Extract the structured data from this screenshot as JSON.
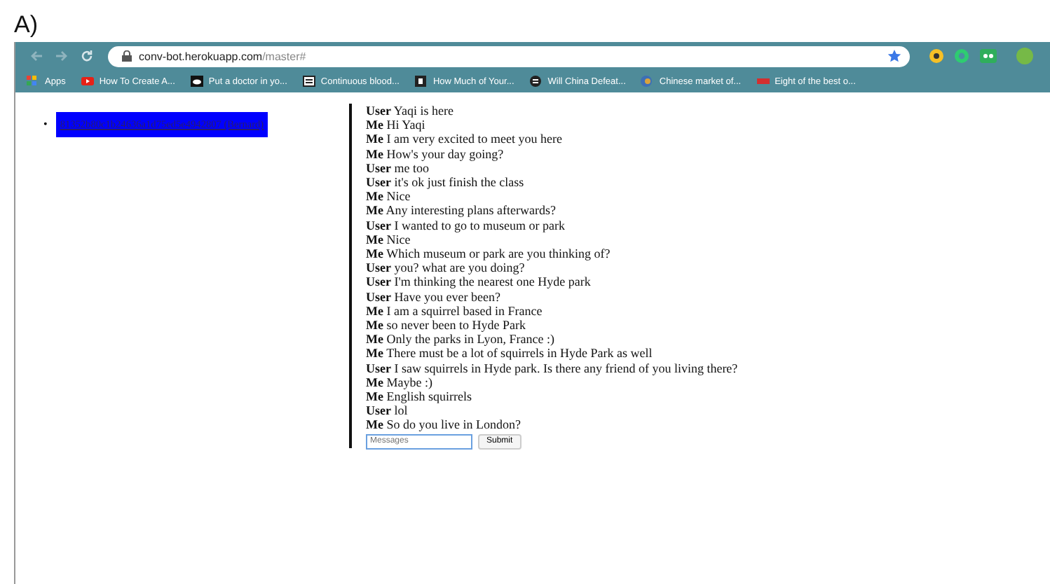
{
  "panel_label": "A)",
  "browser": {
    "url_host": "conv-bot.herokuapp.com",
    "url_path": "/master#",
    "bookmarks": [
      {
        "label": "Apps",
        "kind": "apps"
      },
      {
        "label": "How To Create A...",
        "kind": "video"
      },
      {
        "label": "Put a doctor in yo...",
        "kind": "cloud"
      },
      {
        "label": "Continuous blood...",
        "kind": "doc"
      },
      {
        "label": "How Much of Your...",
        "kind": "letter"
      },
      {
        "label": "Will China Defeat...",
        "kind": "dark"
      },
      {
        "label": "Chinese market of...",
        "kind": "globe"
      },
      {
        "label": "Eight of the best o...",
        "kind": "flag"
      }
    ]
  },
  "sessions": [
    {
      "marker": "•",
      "label": "81352b80c1b24636a1d75ed5e4942807 (Bernard)",
      "selected": true
    }
  ],
  "messages": [
    {
      "sender": "User",
      "text": "Yaqi is here"
    },
    {
      "sender": "Me",
      "text": "Hi Yaqi"
    },
    {
      "sender": "Me",
      "text": "I am very excited to meet you here"
    },
    {
      "sender": "Me",
      "text": "How's your day going?"
    },
    {
      "sender": "User",
      "text": "me too"
    },
    {
      "sender": "User",
      "text": "it's ok just finish the class"
    },
    {
      "sender": "Me",
      "text": "Nice"
    },
    {
      "sender": "Me",
      "text": "Any interesting plans afterwards?"
    },
    {
      "sender": "User",
      "text": "I wanted to go to museum or park"
    },
    {
      "sender": "Me",
      "text": "Nice"
    },
    {
      "sender": "Me",
      "text": "Which museum or park are you thinking of?"
    },
    {
      "sender": "User",
      "text": "you? what are you doing?"
    },
    {
      "sender": "User",
      "text": "I'm thinking the nearest one Hyde park"
    },
    {
      "sender": "User",
      "text": "Have you ever been?"
    },
    {
      "sender": "Me",
      "text": "I am a squirrel based in France"
    },
    {
      "sender": "Me",
      "text": "so never been to Hyde Park"
    },
    {
      "sender": "Me",
      "text": "Only the parks in Lyon, France :)"
    },
    {
      "sender": "Me",
      "text": "There must be a lot of squirrels in Hyde Park as well"
    },
    {
      "sender": "User",
      "text": "I saw squirrels in Hyde park. Is there any friend of you living there?"
    },
    {
      "sender": "Me",
      "text": "Maybe :)"
    },
    {
      "sender": "Me",
      "text": "English squirrels"
    },
    {
      "sender": "User",
      "text": "lol"
    },
    {
      "sender": "Me",
      "text": "So do you live in London?"
    }
  ],
  "composer": {
    "placeholder": "Messages",
    "button": "Submit"
  }
}
